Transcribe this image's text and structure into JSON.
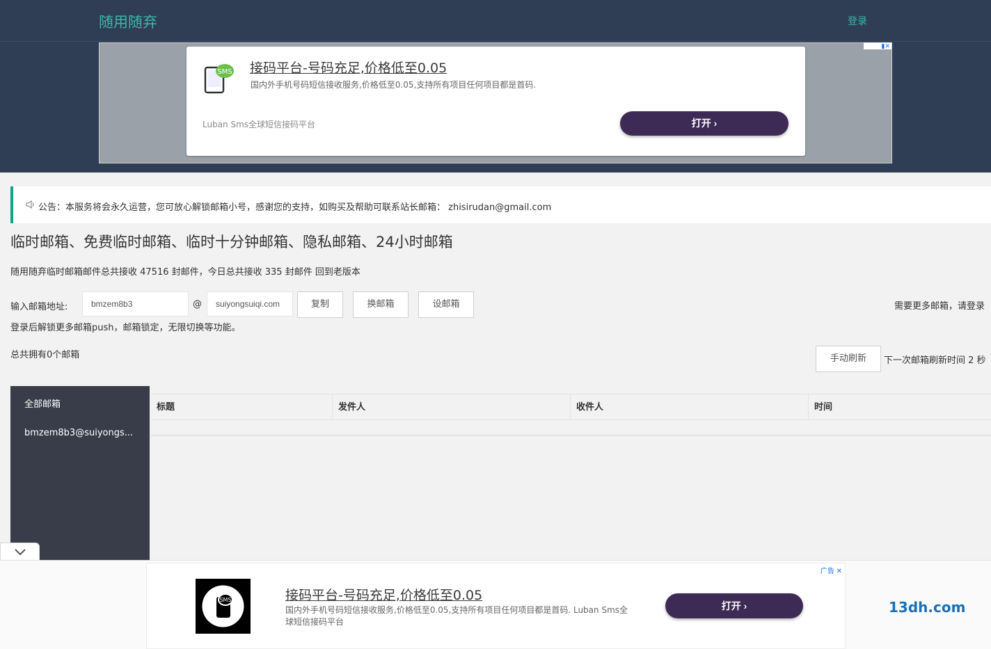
{
  "header": {
    "logo": "随用随弃",
    "login": "登录"
  },
  "ad_top": {
    "title": "接码平台-号码充足,价格低至0.05",
    "description": "国内外手机号码短信接收服务,价格低至0.05,支持所有项目任何项目都是首码.",
    "brand": "Luban Sms全球短信接码平台",
    "open_label": "打开 ›",
    "badge_icon": "sms-icon"
  },
  "notice": {
    "text": "公告：本服务将会永久运营，您可放心解锁邮箱小号，感谢您的支持，如购买及帮助可联系站长邮箱：  zhisirudan@gmail.com"
  },
  "page": {
    "heading": "临时邮箱、免费临时邮箱、临时十分钟邮箱、隐私邮箱、24小时邮箱",
    "stats": "随用随弃临时邮箱邮件总共接收 47516 封邮件，今日总共接收 335 封邮件 回到老版本"
  },
  "form": {
    "label": "输入邮箱地址:",
    "username": "bmzem8b3",
    "at": "@",
    "domain": "suiyongsuiqi.com",
    "copy_button": "复制",
    "change_button": "换邮箱",
    "set_button": "设邮箱",
    "more_hint": "需要更多邮箱，请登录",
    "unlock_hint": "登录后解锁更多邮箱push，邮箱锁定，无限切换等功能。"
  },
  "mailbox": {
    "count_text": "总共拥有0个邮箱",
    "refresh_button": "手动刷新",
    "next_refresh": "下一次邮箱刷新时间 2 秒"
  },
  "sidebar": {
    "items": [
      {
        "label": "全部邮箱"
      },
      {
        "label": "bmzem8b3@suiyongs..."
      }
    ]
  },
  "table": {
    "columns": [
      "标题",
      "发件人",
      "收件人",
      "时间"
    ]
  },
  "ad_bottom": {
    "ad_label": "广告",
    "title": "接码平台-号码充足,价格低至0.05",
    "description": "国内外手机号码短信接收服务,价格低至0.05,支持所有项目任何项目都是首码. Luban Sms全球短信接码平台",
    "open_label": "打开  ›"
  },
  "footer": {
    "domain": "13dh.com"
  },
  "colors": {
    "header_bg": "#2f3e54",
    "accent_teal": "#3fb5a8",
    "notice_border": "#15a08a",
    "sidebar_bg": "#393d49",
    "ad_button": "#3d2b55"
  }
}
